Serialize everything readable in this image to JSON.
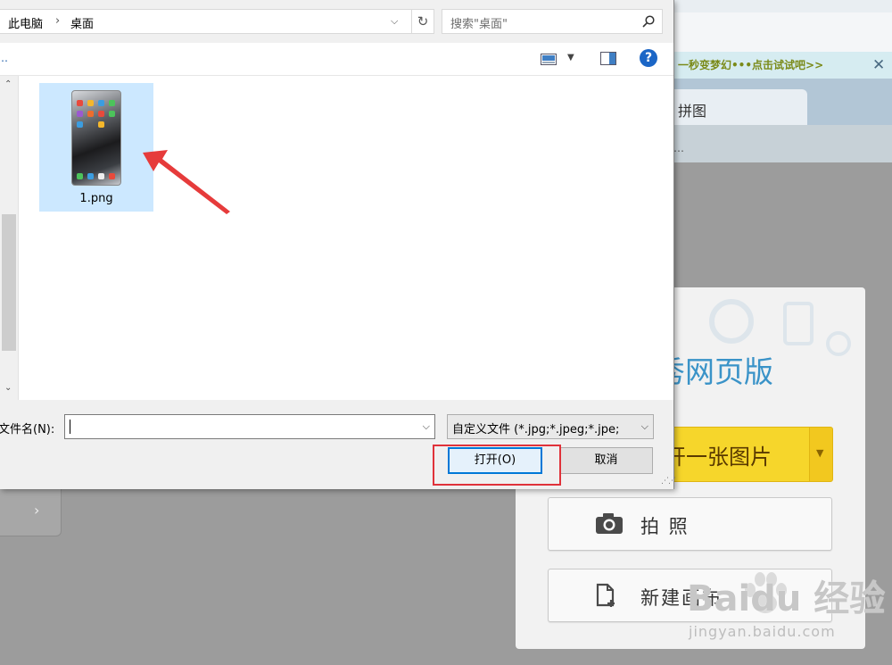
{
  "dialog": {
    "breadcrumb": [
      "此电脑",
      "桌面"
    ],
    "breadcrumb_sep": "›",
    "search_placeholder": "搜索\"桌面\"",
    "toolbar_left_label": "…",
    "help_label": "?",
    "file": {
      "name": "1.png"
    },
    "filename_label": "文件名(N):",
    "filename_value": "",
    "filetype_value": "自定义文件 (*.jpg;*.jpeg;*.jpe;",
    "open_button": "打开(O)",
    "cancel_button": "取消"
  },
  "background_page": {
    "promo_text": "一秒变梦幻•••点击试试吧>>",
    "promo_close": "✕",
    "tab_label": "拼图",
    "subbar_text": "…",
    "brand": "秀网页版",
    "open_image_button": "开一张图片",
    "photo_button": "拍 照",
    "new_canvas_button": "新建画布"
  },
  "watermark": {
    "text": "Baidu 经验",
    "sub": "jingyan.baidu.com"
  },
  "colors": {
    "highlight": "#e0323a",
    "selection": "#cce8ff",
    "accent": "#0078d7",
    "yellow_button": "#f6d62b",
    "brand": "#3a93c8"
  }
}
